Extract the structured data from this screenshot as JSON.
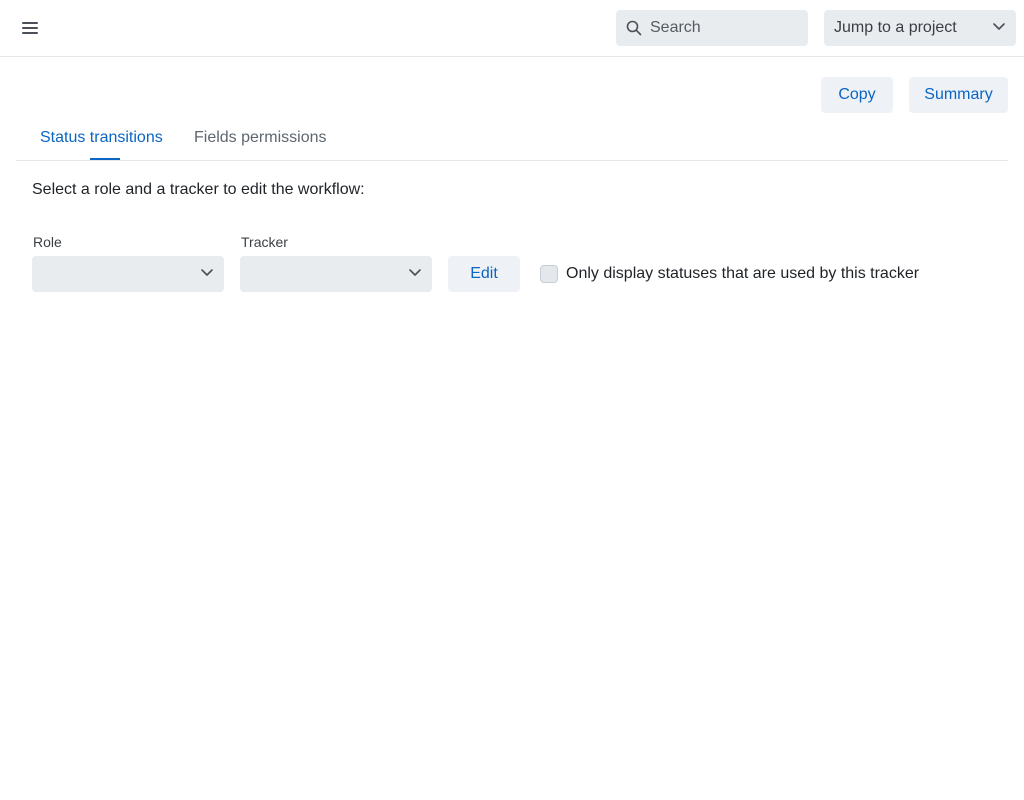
{
  "header": {
    "menu_icon": "hamburger-menu-icon",
    "search_placeholder": "Search",
    "search_icon": "search-icon",
    "jump_label": "Jump to a project",
    "jump_icon": "chevron-down-icon"
  },
  "actions": {
    "copy_label": "Copy",
    "summary_label": "Summary"
  },
  "tabs": [
    {
      "label": "Status transitions",
      "active": true
    },
    {
      "label": "Fields permissions",
      "active": false
    }
  ],
  "main": {
    "intro": "Select a role and a tracker to edit the workflow:",
    "role_label": "Role",
    "role_value": "",
    "tracker_label": "Tracker",
    "tracker_value": "",
    "edit_label": "Edit",
    "only_used_label": "Only display statuses that are used by this tracker",
    "only_used_checked": false
  },
  "colors": {
    "accent": "#0a66c2",
    "control_bg": "#e9ecef",
    "button_bg": "#eef1f5",
    "border": "#e5e7eb"
  }
}
